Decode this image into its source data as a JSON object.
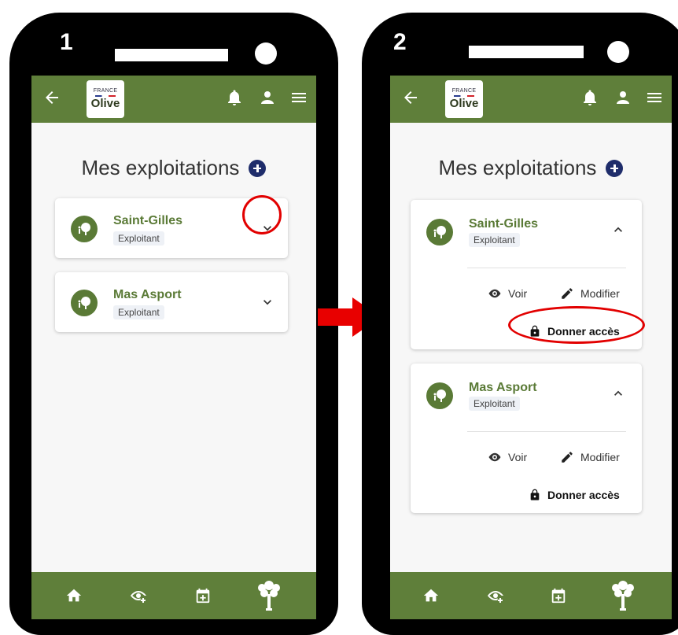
{
  "steps": [
    "1",
    "2"
  ],
  "app": {
    "logo_top": "FRANCE",
    "logo_main": "Olive"
  },
  "page": {
    "title": "Mes exploitations"
  },
  "farms": [
    {
      "name": "Saint-Gilles",
      "role": "Exploitant"
    },
    {
      "name": "Mas Asport",
      "role": "Exploitant"
    }
  ],
  "actions": {
    "view": "Voir",
    "edit": "Modifier",
    "give_access": "Donner accès"
  },
  "icons": {
    "appbar": [
      "back-arrow-icon",
      "bell-icon",
      "user-icon",
      "menu-icon"
    ],
    "bottom_nav": [
      "home-icon",
      "eye-plus-icon",
      "calendar-plus-icon",
      "olive-tree-icon"
    ]
  },
  "colors": {
    "brand_green": "#5f7f3a",
    "accent_navy": "#1f2d6b",
    "highlight_red": "#e20000"
  }
}
